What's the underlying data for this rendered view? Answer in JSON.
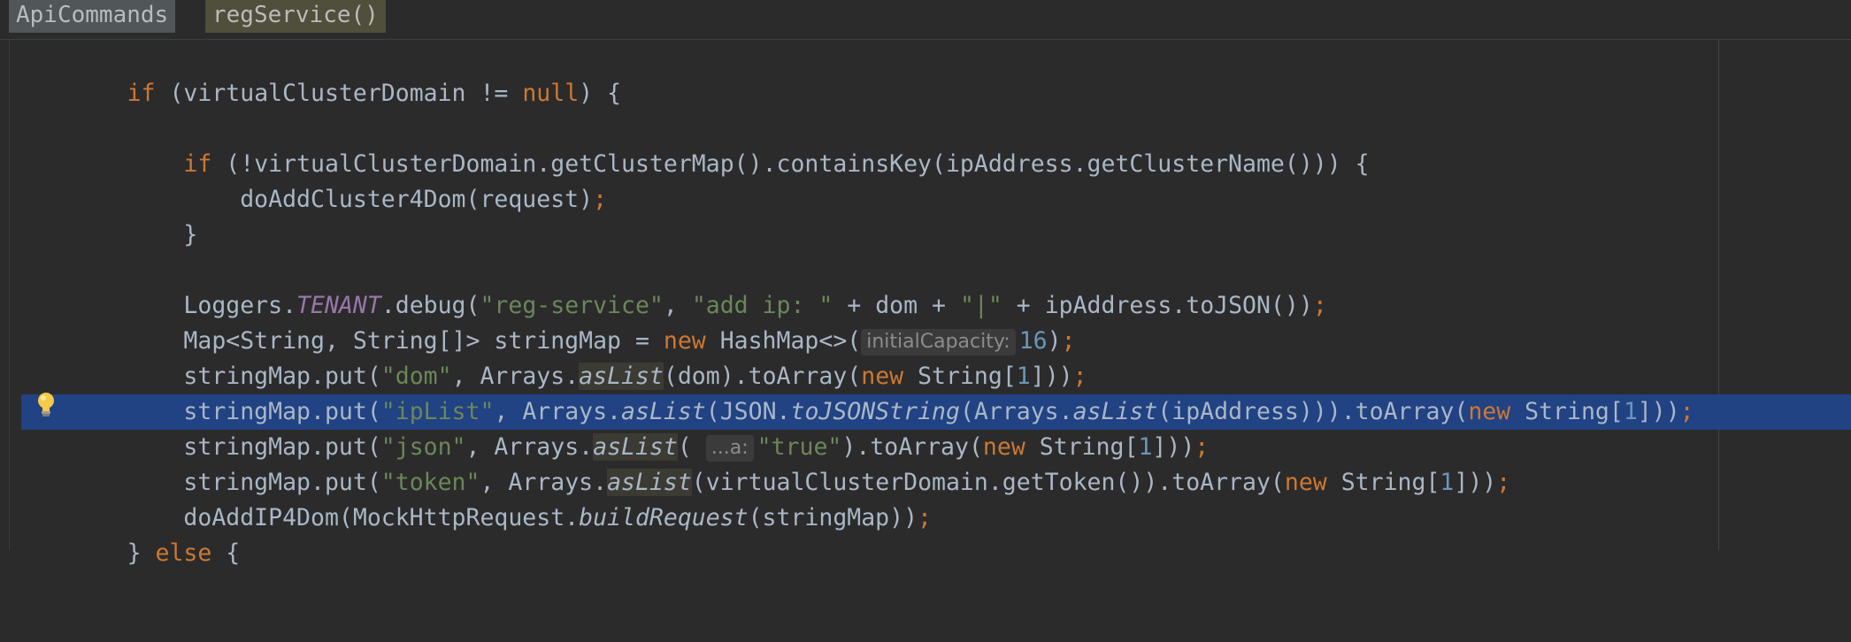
{
  "breadcrumb": {
    "class_name": "ApiCommands",
    "method_name": "regService()"
  },
  "editor": {
    "selected_line": "stringMap.put(\"ipList\", Arrays.asList(JSON.toJSONString(Arrays.asList(ipAddress))).toArray(new String[1]));",
    "hints": {
      "initial_capacity": "initialCapacity:",
      "varargs": "...a:"
    },
    "gutter_icon": "lightbulb-icon",
    "colors": {
      "background": "#2b2b2b",
      "selection": "#214283",
      "keyword": "#cc7832",
      "string": "#6a8759",
      "number": "#6897bb",
      "static_field": "#9876aa"
    }
  }
}
